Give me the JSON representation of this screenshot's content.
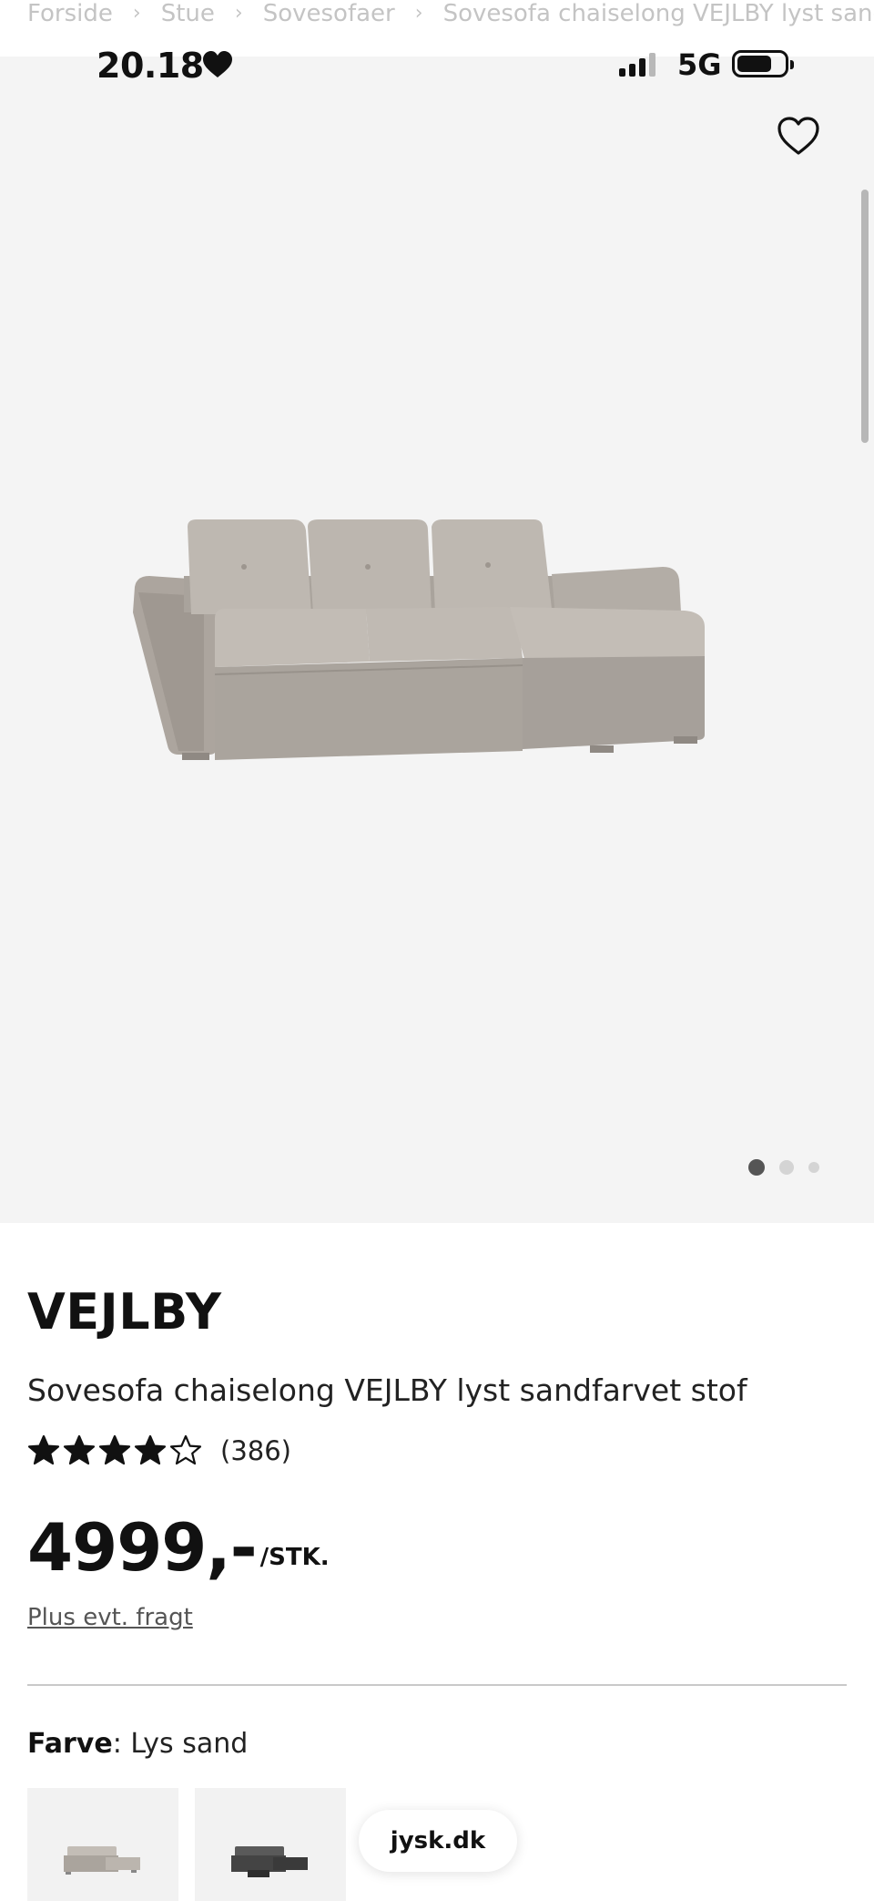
{
  "breadcrumb": {
    "items": [
      "Forside",
      "Stue",
      "Sovesofaer",
      "Sovesofa chaiselong VEJLBY lyst sandfa"
    ],
    "separator": "›"
  },
  "status_bar": {
    "time": "20.18",
    "network": "5G",
    "icons": [
      "heart-icon",
      "signal-icon",
      "battery-icon"
    ]
  },
  "gallery": {
    "image_count": 3,
    "active_index": 0,
    "icons": [
      "heart-outline-icon"
    ]
  },
  "product": {
    "brand": "VEJLBY",
    "name": "Sovesofa chaiselong VEJLBY lyst sandfarvet stof",
    "rating": 4,
    "rating_max": 5,
    "review_count": "(386)",
    "price": "4999,-",
    "price_unit": "/STK.",
    "shipping_note": "Plus evt. fragt"
  },
  "color": {
    "label": "Farve",
    "separator": ": ",
    "value": "Lys sand",
    "swatches": [
      "light-sand",
      "dark-grey"
    ]
  },
  "browser": {
    "url": "jysk.dk"
  },
  "colors": {
    "text": "#111111",
    "muted": "#555555",
    "hero_bg": "#f4f4f4",
    "sofa": "#b8b2ab"
  }
}
